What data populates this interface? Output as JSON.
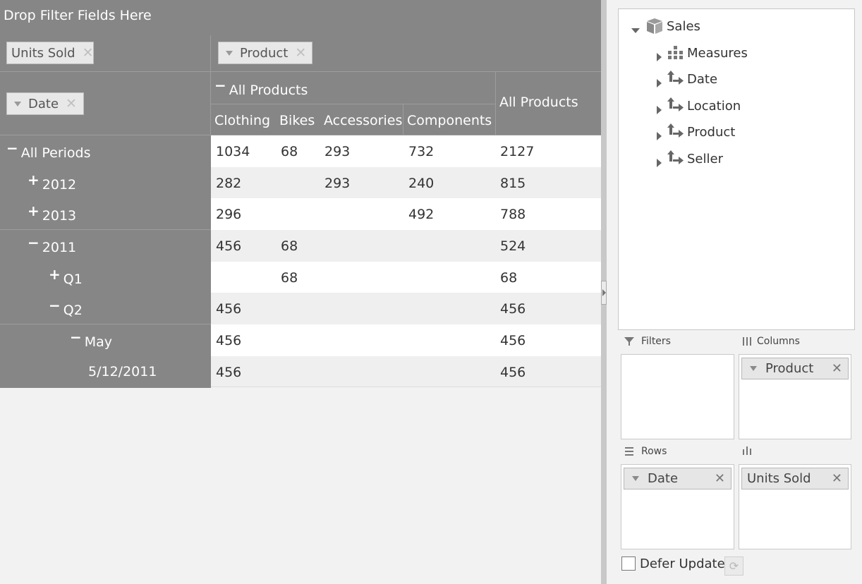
{
  "pivot": {
    "filter_drop_text": "Drop Filter Fields Here",
    "data_field_chip": "Units Sold",
    "column_field_chip": "Product",
    "row_field_chip": "Date",
    "column_header_total": "All Products",
    "column_header_group": "All Products",
    "columns": [
      "Clothing",
      "Bikes",
      "Accessories",
      "Components"
    ],
    "rows": [
      {
        "sign": "−",
        "label": "All Periods",
        "values": [
          "1034",
          "68",
          "293",
          "732",
          "2127"
        ]
      },
      {
        "sign": "+",
        "label": "2012",
        "values": [
          "282",
          "",
          "293",
          "240",
          "815"
        ]
      },
      {
        "sign": "+",
        "label": "2013",
        "values": [
          "296",
          "",
          "",
          "492",
          "788"
        ]
      },
      {
        "sign": "−",
        "label": "2011",
        "values": [
          "456",
          "68",
          "",
          "",
          "524"
        ]
      },
      {
        "sign": "+",
        "label": "Q1",
        "values": [
          "",
          "68",
          "",
          "",
          "68"
        ]
      },
      {
        "sign": "−",
        "label": "Q2",
        "values": [
          "456",
          "",
          "",
          "",
          "456"
        ]
      },
      {
        "sign": "−",
        "label": "May",
        "values": [
          "456",
          "",
          "",
          "",
          "456"
        ]
      },
      {
        "sign": "",
        "label": "5/12/2011",
        "values": [
          "456",
          "",
          "",
          "",
          "456"
        ]
      }
    ],
    "remove_glyph": "✕"
  },
  "field_list": {
    "cube": "Sales",
    "fields": [
      "Measures",
      "Date",
      "Location",
      "Product",
      "Seller"
    ],
    "zones": {
      "filters_label": "Filters",
      "columns_label": "Columns",
      "rows_label": "Rows",
      "values_label": "",
      "columns_chip": "Product",
      "rows_chip": "Date",
      "values_chip": "Units Sold"
    },
    "defer_update_label": "Defer Update",
    "remove_glyph": "✕"
  },
  "colors": {
    "header_gray": "#868686",
    "panel_bg": "#f2f2f2",
    "row_alt": "#efefef"
  }
}
